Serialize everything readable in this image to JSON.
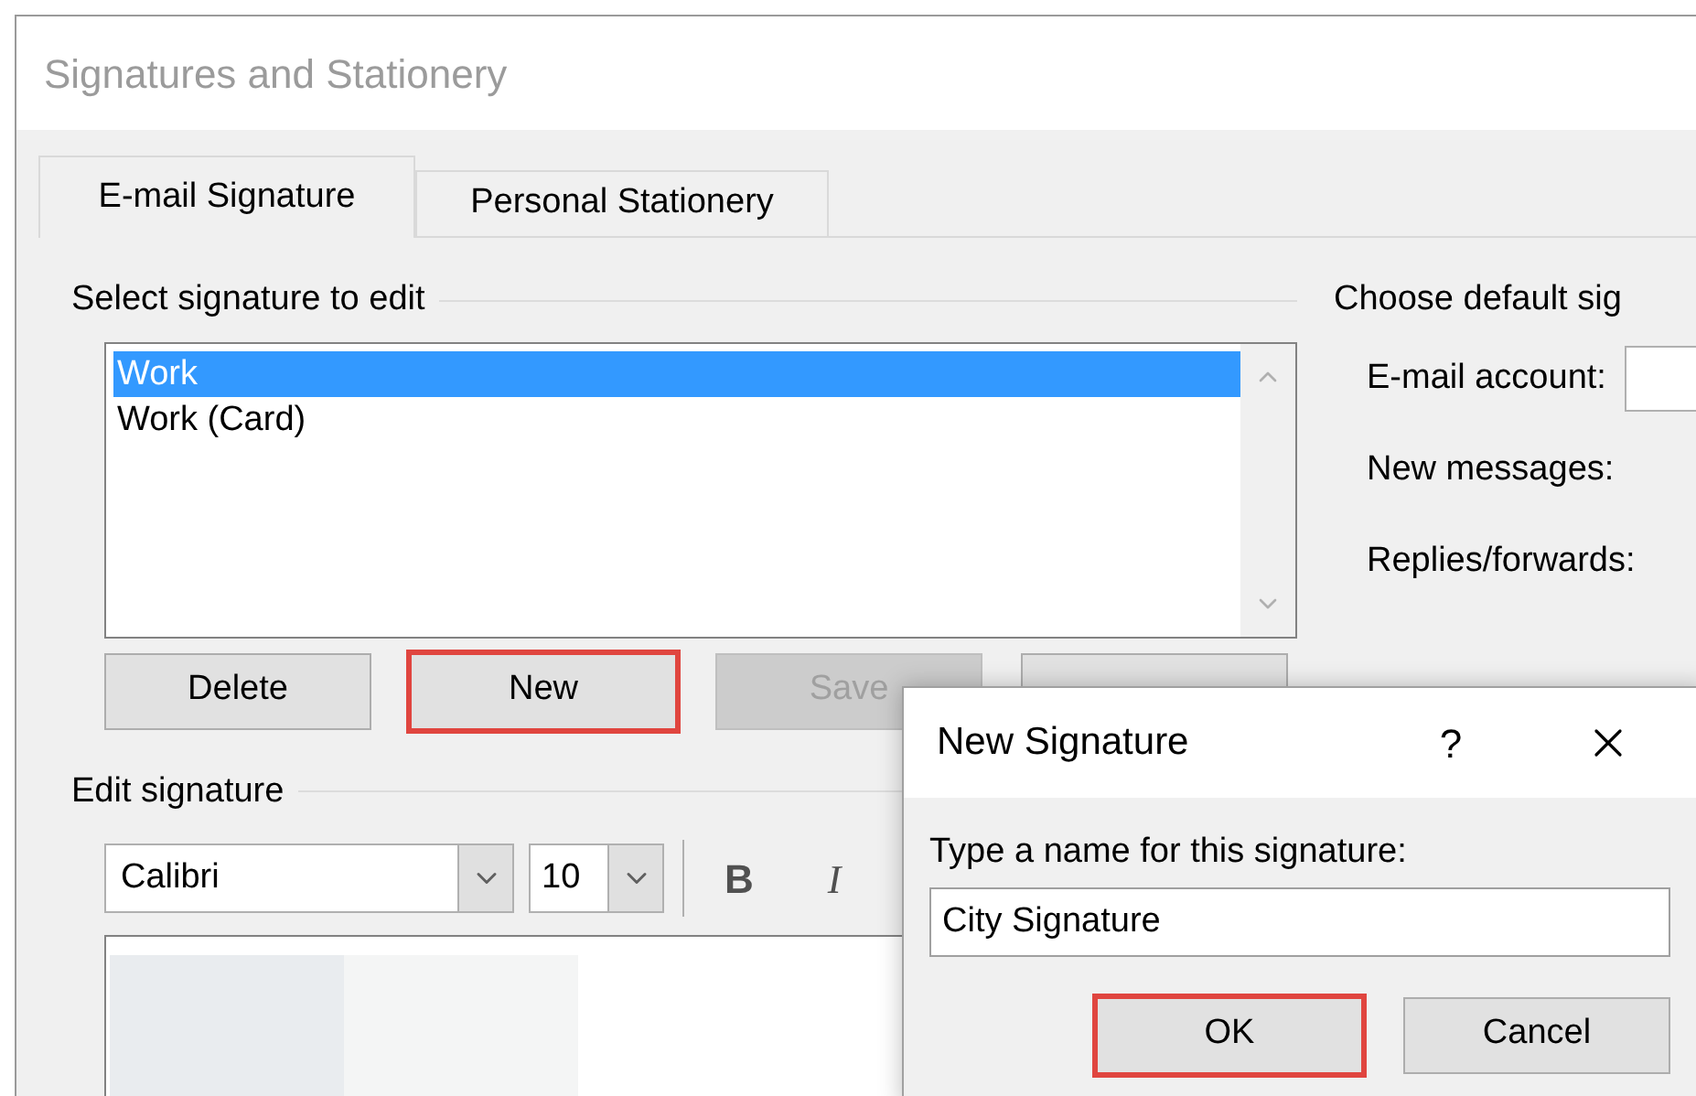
{
  "window": {
    "title": "Signatures and Stationery"
  },
  "tabs": [
    {
      "label": "E-mail Signature",
      "selected": true
    },
    {
      "label": "Personal Stationery",
      "selected": false
    }
  ],
  "select_group": {
    "title": "Select signature to edit",
    "signatures": [
      {
        "name": "Work",
        "selected": true
      },
      {
        "name": "Work (Card)",
        "selected": false
      }
    ],
    "buttons": [
      {
        "label": "Delete",
        "disabled": false,
        "highlighted": false
      },
      {
        "label": "New",
        "disabled": false,
        "highlighted": true
      },
      {
        "label": "Save",
        "disabled": true,
        "highlighted": false
      },
      {
        "disabled": false,
        "highlighted": false
      }
    ]
  },
  "default_group": {
    "title": "Choose default sig",
    "fields": [
      {
        "label": "E-mail account:",
        "kind": "dropdown"
      },
      {
        "label": "New messages:",
        "kind": "label"
      },
      {
        "label": "Replies/forwards:",
        "kind": "label"
      }
    ]
  },
  "edit_group": {
    "title": "Edit signature",
    "font": "Calibri",
    "size": "10",
    "format_buttons": [
      "B",
      "I"
    ]
  },
  "dialog": {
    "title": "New Signature",
    "help": "?",
    "prompt": "Type a name for this signature:",
    "value": "City Signature",
    "buttons": [
      {
        "label": "OK",
        "highlighted": true
      },
      {
        "label": "Cancel",
        "highlighted": false
      }
    ]
  }
}
